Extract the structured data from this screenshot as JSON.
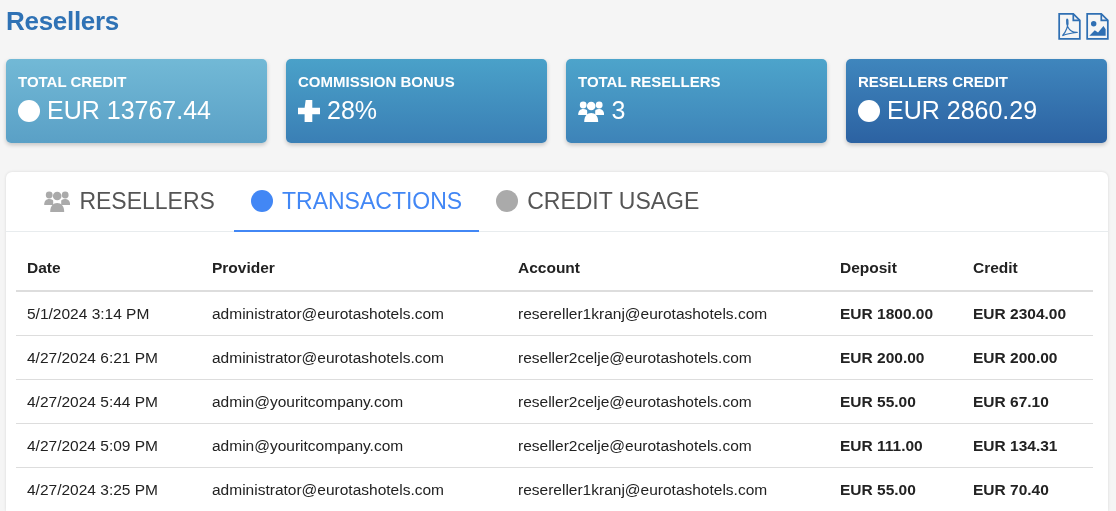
{
  "page": {
    "title": "Resellers"
  },
  "export_buttons": [
    {
      "kind": "pdf"
    },
    {
      "kind": "image"
    }
  ],
  "stats": [
    {
      "label": "TOTAL CREDIT",
      "kind": "circle",
      "value": "EUR 13767.44"
    },
    {
      "label": "COMMISSION BONUS",
      "kind": "plus",
      "value": "28%"
    },
    {
      "label": "TOTAL RESELLERS",
      "kind": "users",
      "value": "3"
    },
    {
      "label": "RESELLERS CREDIT",
      "kind": "circle",
      "value": "EUR 2860.29"
    }
  ],
  "tabs": [
    {
      "label": "RESELLERS",
      "kind": "users",
      "selected": false
    },
    {
      "label": "TRANSACTIONS",
      "kind": "circle",
      "selected": true
    },
    {
      "label": "CREDIT USAGE",
      "kind": "circle",
      "selected": false
    }
  ],
  "table": {
    "columns": [
      "Date",
      "Provider",
      "Account",
      "Deposit",
      "Credit"
    ],
    "rows": [
      [
        "5/1/2024 3:14 PM",
        "administrator@eurotashotels.com",
        "resereller1kranj@eurotashotels.com",
        "EUR 1800.00",
        "EUR 2304.00"
      ],
      [
        "4/27/2024 6:21 PM",
        "administrator@eurotashotels.com",
        "reseller2celje@eurotashotels.com",
        "EUR 200.00",
        "EUR 200.00"
      ],
      [
        "4/27/2024 5:44 PM",
        "admin@youritcompany.com",
        "reseller2celje@eurotashotels.com",
        "EUR 55.00",
        "EUR 67.10"
      ],
      [
        "4/27/2024 5:09 PM",
        "admin@youritcompany.com",
        "reseller2celje@eurotashotels.com",
        "EUR 111.00",
        "EUR 134.31"
      ],
      [
        "4/27/2024 3:25 PM",
        "administrator@eurotashotels.com",
        "resereller1kranj@eurotashotels.com",
        "EUR 55.00",
        "EUR 70.40"
      ]
    ]
  }
}
